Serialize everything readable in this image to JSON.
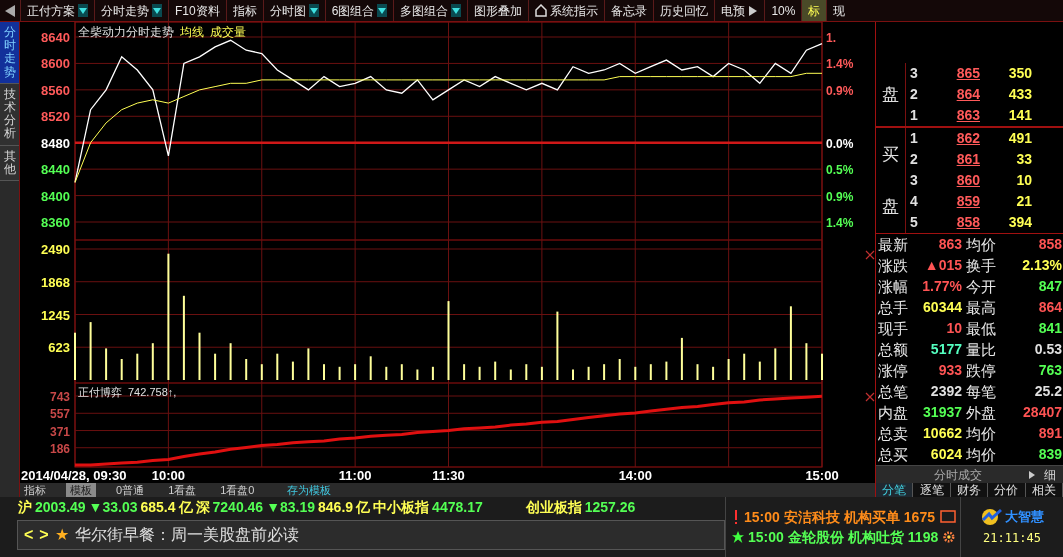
{
  "toolbar": {
    "items": [
      {
        "label": "正付方案",
        "dropdown": true,
        "selected": false
      },
      {
        "label": "分时走势",
        "dropdown": true,
        "selected": false
      },
      {
        "label": "F10资料",
        "dropdown": false,
        "selected": false
      },
      {
        "label": "指标",
        "dropdown": false,
        "selected": false
      },
      {
        "label": "分时图",
        "dropdown": true,
        "selected": false
      },
      {
        "label": "6图组合",
        "dropdown": true,
        "selected": false
      },
      {
        "label": "多图组合",
        "dropdown": true,
        "selected": false
      },
      {
        "label": "图形叠加",
        "dropdown": false,
        "selected": false
      },
      {
        "label": "系统指示",
        "dropdown": false,
        "icon": true,
        "selected": false
      },
      {
        "label": "备忘录",
        "dropdown": false,
        "selected": false
      },
      {
        "label": "历史回忆",
        "dropdown": false,
        "selected": false
      },
      {
        "label": "电预",
        "dropdown": false,
        "arrow": true,
        "selected": false
      },
      {
        "label": "10%",
        "dropdown": false,
        "selected": false
      },
      {
        "label": "标",
        "dropdown": false,
        "selected": true
      },
      {
        "label": "现",
        "dropdown": false,
        "selected": false
      }
    ]
  },
  "side_tabs": [
    {
      "label": "分时走势",
      "selected": true
    },
    {
      "label": "技术分析",
      "selected": false
    },
    {
      "label": "其他",
      "selected": false
    }
  ],
  "price_panel": {
    "chart_data": {
      "type": "line",
      "title": "全柴动力分时走势",
      "series": [
        {
          "color": "#ffffff",
          "values": [
            8420,
            8530,
            8560,
            8610,
            8590,
            8560,
            8460,
            8600,
            8610,
            8625,
            8635,
            8620,
            8615,
            8590,
            8575,
            8560,
            8580,
            8565,
            8570,
            8580,
            8560,
            8555,
            8575,
            8545,
            8560,
            8575,
            8565,
            8580,
            8570,
            8560,
            8570,
            8560,
            8595,
            8585,
            8590,
            8600,
            8585,
            8595,
            8605,
            8590,
            8595,
            8580,
            8600,
            8590,
            8570,
            8600,
            8585,
            8620,
            8630
          ]
        },
        {
          "name": "均线",
          "color": "#ffff54",
          "values": [
            8420,
            8480,
            8510,
            8530,
            8540,
            8545,
            8540,
            8550,
            8560,
            8565,
            8570,
            8570,
            8575,
            8575,
            8575,
            8575,
            8575,
            8575,
            8575,
            8575,
            8575,
            8575,
            8575,
            8575,
            8575,
            8575,
            8575,
            8575,
            8575,
            8575,
            8575,
            8575,
            8575,
            8575,
            8575,
            8580,
            8580,
            8580,
            8580,
            8580,
            8580,
            8580,
            8580,
            8580,
            8580,
            8580,
            8580,
            8585,
            8585
          ]
        }
      ],
      "ylim": [
        8360,
        8640
      ],
      "yticks": [
        8360,
        8400,
        8440,
        8480,
        8520,
        8560,
        8600,
        8640
      ],
      "grid": true,
      "ref_lines": [
        {
          "axis": "y",
          "value": 8480
        }
      ]
    },
    "right_axis": [
      "1.",
      "1.4%",
      "0.9%",
      "0.0%",
      "0.5%",
      "0.9%",
      "1.4%"
    ]
  },
  "volume_panel": {
    "chart_data": {
      "type": "bar",
      "series": [
        {
          "name": "成交量",
          "color": "#ffff9a",
          "values": [
            900,
            1100,
            600,
            400,
            500,
            700,
            2400,
            1600,
            900,
            500,
            700,
            400,
            300,
            500,
            350,
            600,
            300,
            250,
            300,
            450,
            250,
            300,
            200,
            250,
            1500,
            300,
            250,
            350,
            200,
            300,
            250,
            1300,
            200,
            250,
            300,
            400,
            250,
            300,
            350,
            800,
            300,
            250,
            400,
            500,
            350,
            600,
            1400,
            700,
            500
          ]
        }
      ],
      "ylim": [
        0,
        2490
      ],
      "yticks": [
        623,
        1245,
        1868,
        2490
      ],
      "grid": true
    }
  },
  "indicator_panel": {
    "reading": "742.758↑,",
    "chart_data": {
      "type": "line",
      "title": "正付博弈",
      "categories": [
        "2014/04/28, 09:30",
        null,
        null,
        null,
        null,
        null,
        "10:00",
        null,
        null,
        null,
        null,
        null,
        null,
        null,
        null,
        null,
        null,
        null,
        "11:00",
        null,
        null,
        null,
        null,
        null,
        "11:30",
        null,
        null,
        null,
        null,
        null,
        null,
        null,
        null,
        null,
        null,
        null,
        "14:00",
        null,
        null,
        null,
        null,
        null,
        null,
        null,
        null,
        null,
        null,
        null,
        "15:00"
      ],
      "series": [
        {
          "color": "#e01010",
          "values": [
            0,
            0,
            10,
            20,
            30,
            50,
            60,
            90,
            120,
            140,
            170,
            190,
            210,
            220,
            240,
            250,
            260,
            280,
            290,
            310,
            320,
            330,
            350,
            360,
            370,
            390,
            400,
            410,
            430,
            440,
            460,
            470,
            490,
            510,
            530,
            550,
            560,
            580,
            600,
            620,
            630,
            650,
            670,
            680,
            700,
            710,
            720,
            730,
            740
          ]
        }
      ],
      "ylim": [
        0,
        743
      ],
      "yticks": [
        186,
        371,
        557,
        743
      ],
      "grid": true
    }
  },
  "chart_tabs": [
    {
      "label": "指标",
      "kind": "tab",
      "selected": false
    },
    {
      "label": "模板",
      "kind": "tab",
      "selected": true
    },
    {
      "label": "0普通",
      "kind": "tab",
      "selected": false
    },
    {
      "label": "1看盘",
      "kind": "tab",
      "selected": false
    },
    {
      "label": "1看盘0",
      "kind": "tab",
      "selected": false
    },
    {
      "label": "存为模板",
      "kind": "action",
      "selected": false
    }
  ],
  "order_book": {
    "sell": {
      "label_chars": [
        "盘"
      ],
      "rows": [
        {
          "level": "3",
          "price": "865",
          "volume": "350"
        },
        {
          "level": "2",
          "price": "864",
          "volume": "433"
        },
        {
          "level": "1",
          "price": "863",
          "volume": "141"
        }
      ]
    },
    "buy": {
      "label_chars": [
        "买",
        "盘"
      ],
      "rows": [
        {
          "level": "1",
          "price": "862",
          "volume": "491"
        },
        {
          "level": "2",
          "price": "861",
          "volume": "33"
        },
        {
          "level": "3",
          "price": "860",
          "volume": "10"
        },
        {
          "level": "4",
          "price": "859",
          "volume": "21"
        },
        {
          "level": "5",
          "price": "858",
          "volume": "394"
        }
      ]
    }
  },
  "stats": [
    {
      "label": "最新",
      "value": "863",
      "color": "#ff5454"
    },
    {
      "label": "均价",
      "value": "858",
      "color": "#ff5454"
    },
    {
      "label": "涨跌",
      "value": "▲015",
      "color": "#ff5454"
    },
    {
      "label": "换手",
      "value": "2.13%",
      "color": "#ffff54"
    },
    {
      "label": "涨幅",
      "value": "1.77%",
      "color": "#ff5454"
    },
    {
      "label": "今开",
      "value": "847",
      "color": "#54ff54"
    },
    {
      "label": "总手",
      "value": "60344",
      "color": "#ffff54"
    },
    {
      "label": "最高",
      "value": "864",
      "color": "#ff5454"
    },
    {
      "label": "现手",
      "value": "10",
      "color": "#ff5454"
    },
    {
      "label": "最低",
      "value": "841",
      "color": "#54ff54"
    },
    {
      "label": "总额",
      "value": "5177",
      "color": "#54ffc0"
    },
    {
      "label": "量比",
      "value": "0.53",
      "color": "#e0e0e0"
    },
    {
      "label": "涨停",
      "value": "933",
      "color": "#ff5454"
    },
    {
      "label": "跌停",
      "value": "763",
      "color": "#54ff54"
    },
    {
      "label": "总笔",
      "value": "2392",
      "color": "#e0e0e0"
    },
    {
      "label": "每笔",
      "value": "25.2",
      "color": "#e0e0e0"
    },
    {
      "label": "内盘",
      "value": "31937",
      "color": "#54ff54"
    },
    {
      "label": "外盘",
      "value": "28407",
      "color": "#ff5454"
    },
    {
      "label": "总卖",
      "value": "10662",
      "color": "#ffff54"
    },
    {
      "label": "均价",
      "value": "891",
      "color": "#ff5454"
    },
    {
      "label": "总买",
      "value": "6024",
      "color": "#ffff54"
    },
    {
      "label": "均价",
      "value": "839",
      "color": "#54ff54"
    }
  ],
  "trades_header": {
    "title": "分时成交",
    "detail": "细"
  },
  "right_tabs": [
    {
      "label": "分笔",
      "selected": true
    },
    {
      "label": "逐笔",
      "selected": false
    },
    {
      "label": "财务",
      "selected": false
    },
    {
      "label": "分价",
      "selected": false
    },
    {
      "label": "相关",
      "selected": false
    }
  ],
  "ticker": [
    {
      "text": "沪",
      "color": "#ffff54"
    },
    {
      "text": "2003.49",
      "color": "#54ff54"
    },
    {
      "text": "▼33.03",
      "color": "#54ff54"
    },
    {
      "text": "685.4",
      "color": "#ffff54"
    },
    {
      "text": "亿",
      "color": "#ffff54"
    },
    {
      "text": "深",
      "color": "#ffff54"
    },
    {
      "text": "7240.46",
      "color": "#54ff54"
    },
    {
      "text": "▼83.19",
      "color": "#54ff54"
    },
    {
      "text": "846.9",
      "color": "#ffff54"
    },
    {
      "text": "亿",
      "color": "#ffff54"
    },
    {
      "text": "中小板指",
      "color": "#ffff54"
    },
    {
      "text": "4478.17",
      "color": "#54ff54"
    },
    {
      "text": "创业板指",
      "color": "#ffff54"
    },
    {
      "text": "1257.26",
      "color": "#54ff54"
    }
  ],
  "news": {
    "prev": "<",
    "next": ">",
    "star": "★",
    "text": "华尔街早餐：周一美股盘前必读"
  },
  "alerts": [
    {
      "kind": "alert",
      "time": "15:00",
      "stock": "安洁科技",
      "event": "机构买单",
      "volume": "1675",
      "color": "#ff8c1a"
    },
    {
      "kind": "star",
      "time": "15:00",
      "stock": "金轮股份",
      "event": "机构吐货",
      "volume": "1198",
      "color": "#54ff54"
    }
  ],
  "logo": {
    "text": "大智慧"
  },
  "clock": "21:11:45"
}
